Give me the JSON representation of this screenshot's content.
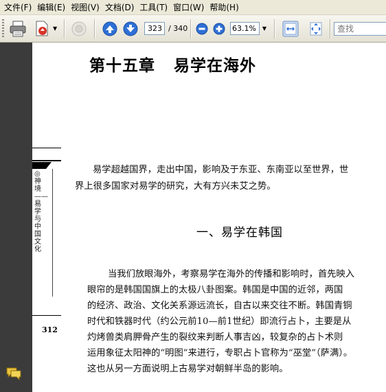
{
  "menu": [
    {
      "name": "menu-file",
      "label": "文件(F)"
    },
    {
      "name": "menu-edit",
      "label": "编辑(E)"
    },
    {
      "name": "menu-view",
      "label": "视图(V)"
    },
    {
      "name": "menu-document",
      "label": "文档(D)"
    },
    {
      "name": "menu-tools",
      "label": "工具(T)"
    },
    {
      "name": "menu-window",
      "label": "窗口(W)"
    },
    {
      "name": "menu-help",
      "label": "帮助(H)"
    }
  ],
  "toolbar": {
    "page_current": "323",
    "page_total": "/ 340",
    "zoom_value": "63.1%",
    "search_placeholder": "查找",
    "accent_blue": "#2e6fd6"
  },
  "document": {
    "chapter_title": "第十五章   易学在海外",
    "intro_lines": [
      "易学超越国界，走出中国，影响及于东亚、东南亚以至世界，世",
      "界上很多国家对易学的研究，大有方兴未艾之势。"
    ],
    "section_title": "一、易学在韩国",
    "body_lines": [
      "当我们放眼海外，考察易学在海外的传播和影响时，首先映入",
      "眼帘的是韩国国旗上的太极八卦图案。韩国是中国的近邻，两国",
      "的经济、政治、文化关系源远流长，自古以来交往不断。韩国青铜",
      "时代和铁器时代（约公元前10—前1世纪）即流行占卜，主要是从",
      "灼烤兽类肩胛骨产生的裂纹来判断人事吉凶，较复杂的占卜术则",
      "运用象征太阳神的“明图”来进行，专职占卜官称为“巫堂”（萨满）。",
      "这也从另一方面说明上古易学对朝鲜半岛的影响。"
    ],
    "prev_page_vertical_text": "◎神境——易学与中国文化",
    "prev_page_number": "312"
  }
}
